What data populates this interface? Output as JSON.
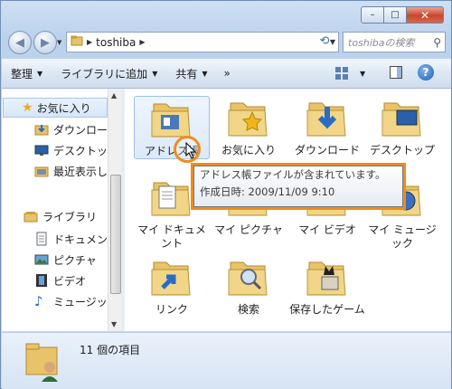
{
  "window": {
    "caption_buttons": {
      "minimize": "–",
      "maximize": "□",
      "close": "✕"
    }
  },
  "nav": {
    "address_segment": "toshiba",
    "search_placeholder": "toshibaの検索"
  },
  "toolbar": {
    "organize": "整理",
    "add_to_library": "ライブラリに追加",
    "share": "共有",
    "more": "»"
  },
  "sidebar": {
    "favorites": "お気に入り",
    "favorite_items": [
      "ダウンロー",
      "デスクトッ",
      "最近表示し"
    ],
    "libraries": "ライブラリ",
    "library_items": [
      "ドキュメン",
      "ピクチャ",
      "ビデオ",
      "ミュージッ"
    ]
  },
  "files": [
    {
      "name": "アドレス帳",
      "icon": "address-book-folder-icon"
    },
    {
      "name": "お気に入り",
      "icon": "favorites-folder-icon"
    },
    {
      "name": "ダウンロード",
      "icon": "downloads-folder-icon"
    },
    {
      "name": "デスクトップ",
      "icon": "desktop-folder-icon"
    },
    {
      "name": "マイ ドキュメント",
      "icon": "documents-folder-icon"
    },
    {
      "name": "マイ ピクチャ",
      "icon": "pictures-folder-icon"
    },
    {
      "name": "マイ ビデオ",
      "icon": "videos-folder-icon"
    },
    {
      "name": "マイ ミュージック",
      "icon": "music-folder-icon"
    },
    {
      "name": "リンク",
      "icon": "links-folder-icon"
    },
    {
      "name": "検索",
      "icon": "searches-folder-icon"
    },
    {
      "name": "保存したゲーム",
      "icon": "saved-games-folder-icon"
    }
  ],
  "tooltip": {
    "line1": "アドレス帳ファイルが含まれています。",
    "line2": "作成日時: 2009/11/09 9:10"
  },
  "status": {
    "count": "11 個の項目"
  },
  "colors": {
    "highlight_ring": "#f08c1a",
    "folder": "#e8c36a"
  }
}
